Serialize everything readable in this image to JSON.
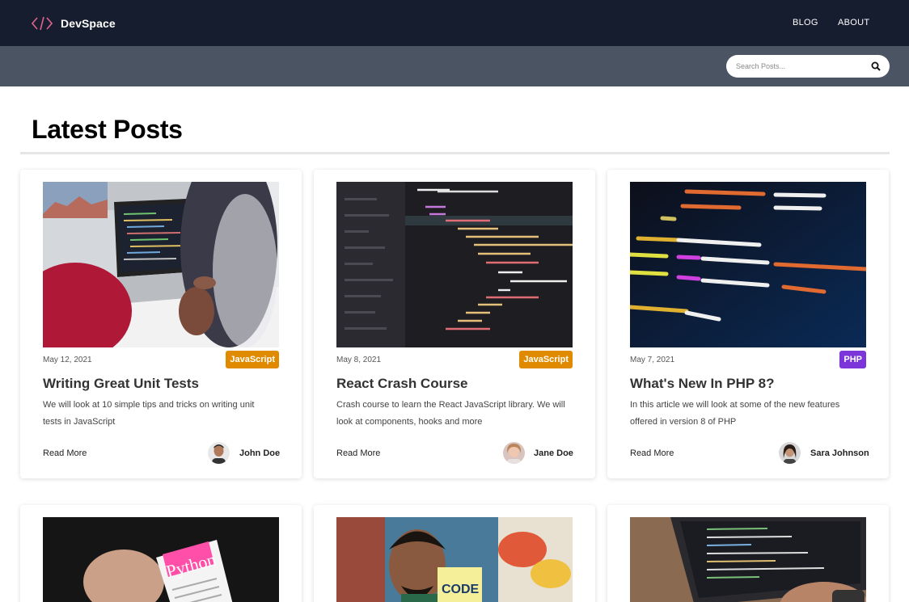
{
  "nav": {
    "brand": "DevSpace",
    "links": [
      {
        "label": "BLOG"
      },
      {
        "label": "ABOUT"
      }
    ]
  },
  "search": {
    "placeholder": "Search Posts..."
  },
  "page": {
    "title": "Latest Posts"
  },
  "posts": [
    {
      "date": "May 12, 2021",
      "category": "JavaScript",
      "category_color": "#e08a00",
      "title": "Writing Great Unit Tests",
      "excerpt": "We will look at 10 simple tips and tricks on writing unit tests in JavaScript",
      "read_more": "Read More",
      "author": "John Doe"
    },
    {
      "date": "May 8, 2021",
      "category": "JavaScript",
      "category_color": "#e08a00",
      "title": "React Crash Course",
      "excerpt": "Crash course to learn the React JavaScript library. We will look at components, hooks and more",
      "read_more": "Read More",
      "author": "Jane Doe"
    },
    {
      "date": "May 7, 2021",
      "category": "PHP",
      "category_color": "#7b35d9",
      "title": "What's New In PHP 8?",
      "excerpt": "In this article we will look at some of the new features offered in version 8 of PHP",
      "read_more": "Read More",
      "author": "Sara Johnson"
    }
  ],
  "second_row": {
    "python_label": "Python",
    "code_note": "CODE"
  }
}
